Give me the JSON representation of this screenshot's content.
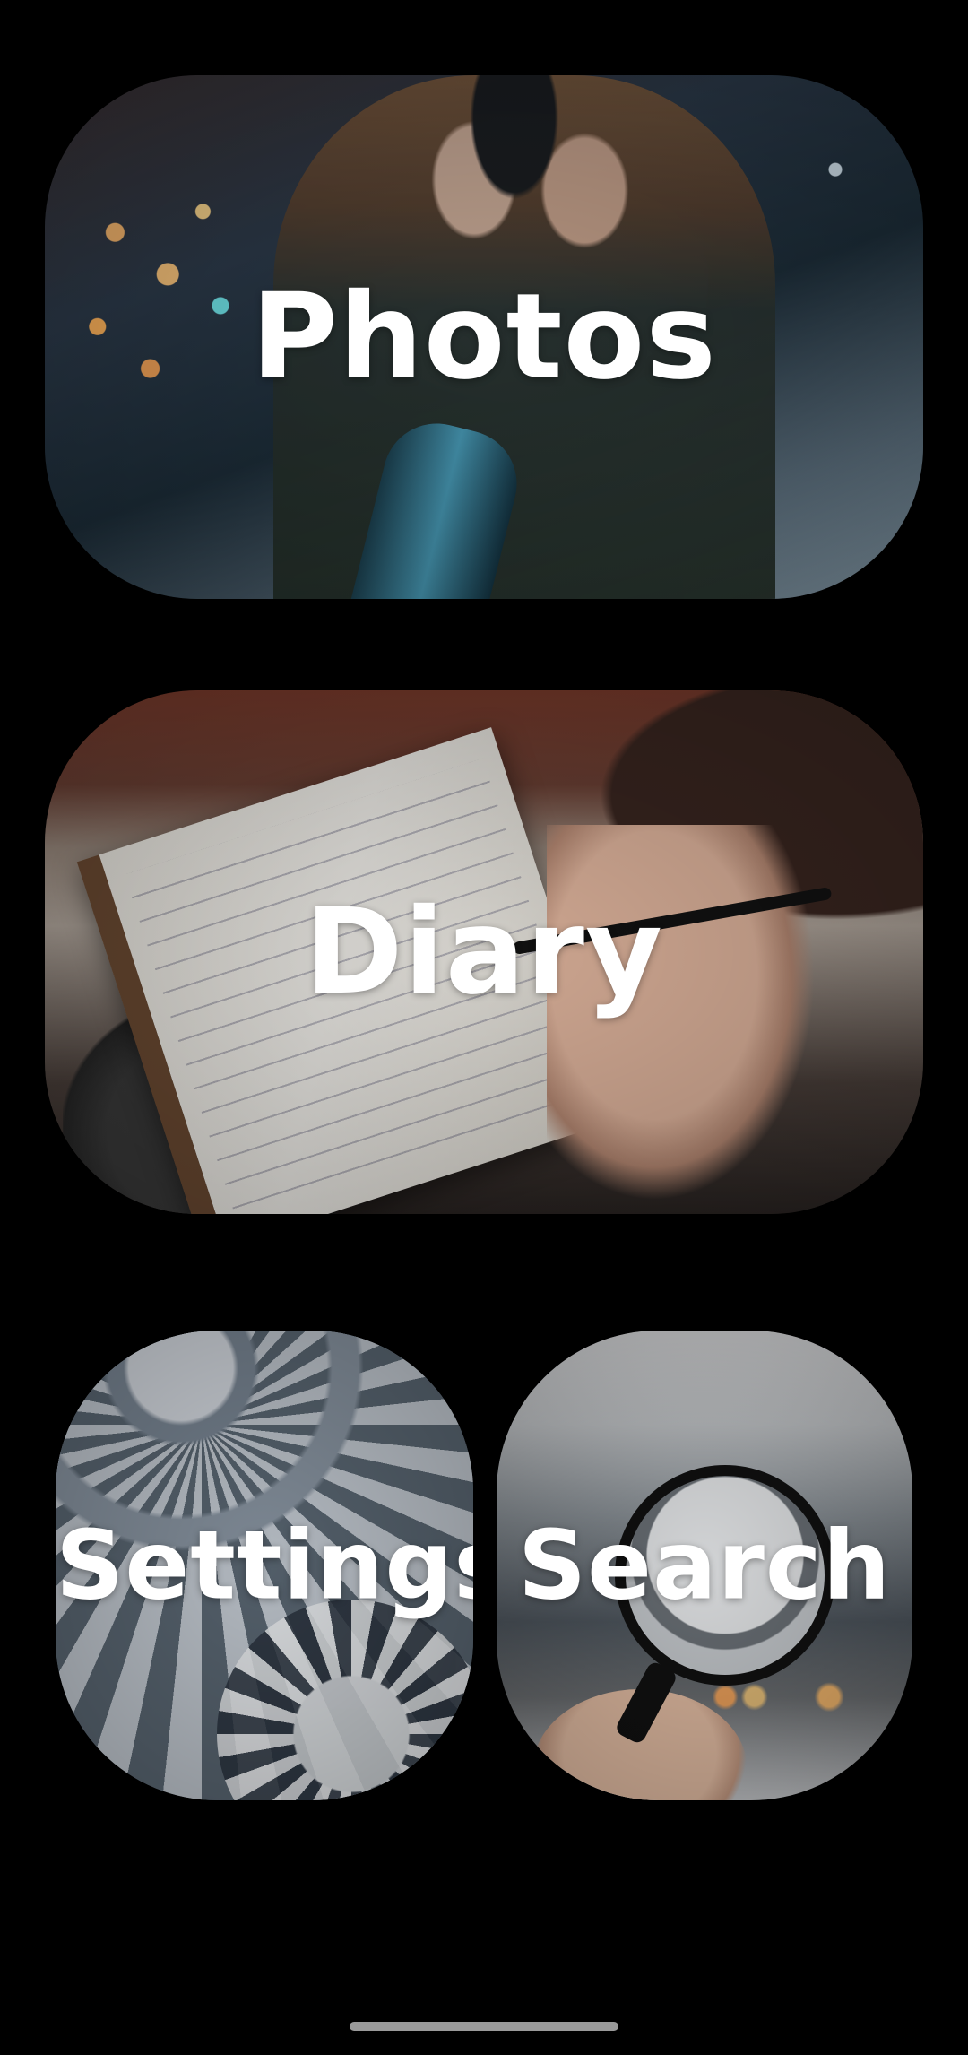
{
  "tiles": {
    "photos": {
      "label": "Photos"
    },
    "diary": {
      "label": "Diary"
    },
    "settings": {
      "label": "Settings"
    },
    "search": {
      "label": "Search"
    }
  },
  "colors": {
    "background": "#000000",
    "label_text": "#ffffff",
    "home_indicator": "#9a9a9a"
  }
}
